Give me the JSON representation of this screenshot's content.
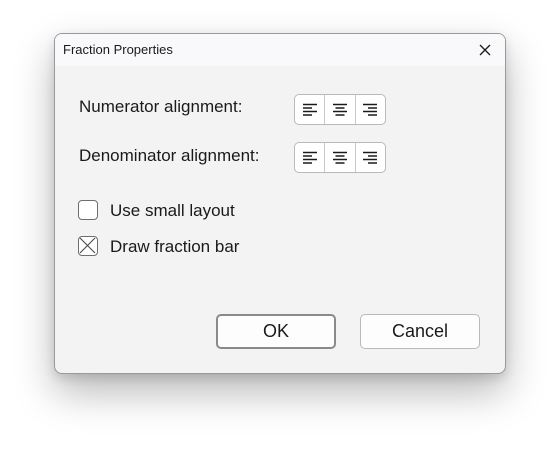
{
  "dialog": {
    "title": "Fraction Properties",
    "close_icon": "close-icon"
  },
  "numerator": {
    "label": "Numerator alignment:",
    "options": [
      {
        "icon": "align-left-icon"
      },
      {
        "icon": "align-center-icon"
      },
      {
        "icon": "align-right-icon"
      }
    ]
  },
  "denominator": {
    "label": "Denominator alignment:",
    "options": [
      {
        "icon": "align-left-icon"
      },
      {
        "icon": "align-center-icon"
      },
      {
        "icon": "align-right-icon"
      }
    ]
  },
  "checkboxes": {
    "small_layout": {
      "label": "Use small layout",
      "checked": false
    },
    "fraction_bar": {
      "label": "Draw fraction bar",
      "checked": true
    }
  },
  "buttons": {
    "ok": "OK",
    "cancel": "Cancel"
  },
  "colors": {
    "dialog_bg": "#f3f3f3",
    "titlebar_bg": "#f9f9fb",
    "border": "#9a9a9a"
  }
}
